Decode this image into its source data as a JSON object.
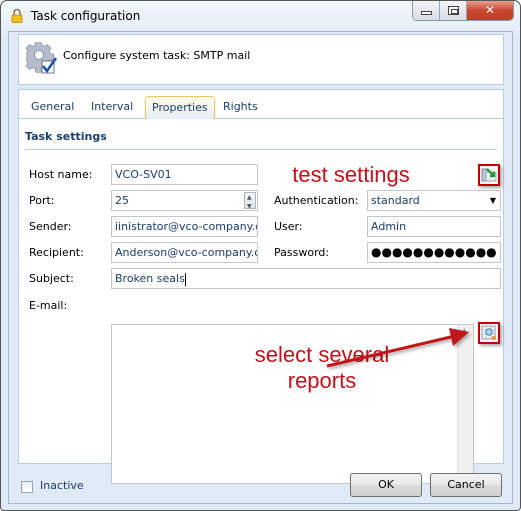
{
  "window": {
    "title": "Task configuration",
    "controls": {
      "minimize": "minimize",
      "maximize": "maximize",
      "close": "✕"
    }
  },
  "header": {
    "text": "Configure system task: SMTP mail",
    "icon": "gear-check-icon"
  },
  "tabs": [
    {
      "label": "General",
      "active": false
    },
    {
      "label": "Interval",
      "active": false
    },
    {
      "label": "Properties",
      "active": true
    },
    {
      "label": "Rights",
      "active": false
    }
  ],
  "section": {
    "title": "Task settings"
  },
  "form": {
    "host_name": {
      "label": "Host name:",
      "value": "VCO-SV01"
    },
    "port": {
      "label": "Port:",
      "value": "25"
    },
    "sender": {
      "label": "Sender:",
      "value": "iinistrator@vco-company.com"
    },
    "recipient": {
      "label": "Recipient:",
      "value": "Anderson@vco-company.com"
    },
    "subject": {
      "label": "Subject:",
      "value": "Broken seals"
    },
    "email": {
      "label": "E-mail:",
      "value": ""
    },
    "authentication": {
      "label": "Authentication:",
      "value": "standard"
    },
    "user": {
      "label": "User:",
      "value": "Admin"
    },
    "password": {
      "label": "Password:",
      "value": "●●●●●●●●●●●●"
    }
  },
  "icons": {
    "test_settings": "test-settings-icon",
    "select_reports": "select-reports-icon"
  },
  "annotations": {
    "test_settings": "test settings",
    "select_reports_line1": "select several",
    "select_reports_line2": "reports"
  },
  "footer": {
    "inactive_label": "Inactive",
    "inactive_checked": false,
    "ok_label": "OK",
    "cancel_label": "Cancel"
  },
  "colors": {
    "annotation": "#c0121a",
    "accent_text": "#1d3e6e",
    "panel_border": "#b9cde5",
    "close_button": "#c9472f"
  }
}
